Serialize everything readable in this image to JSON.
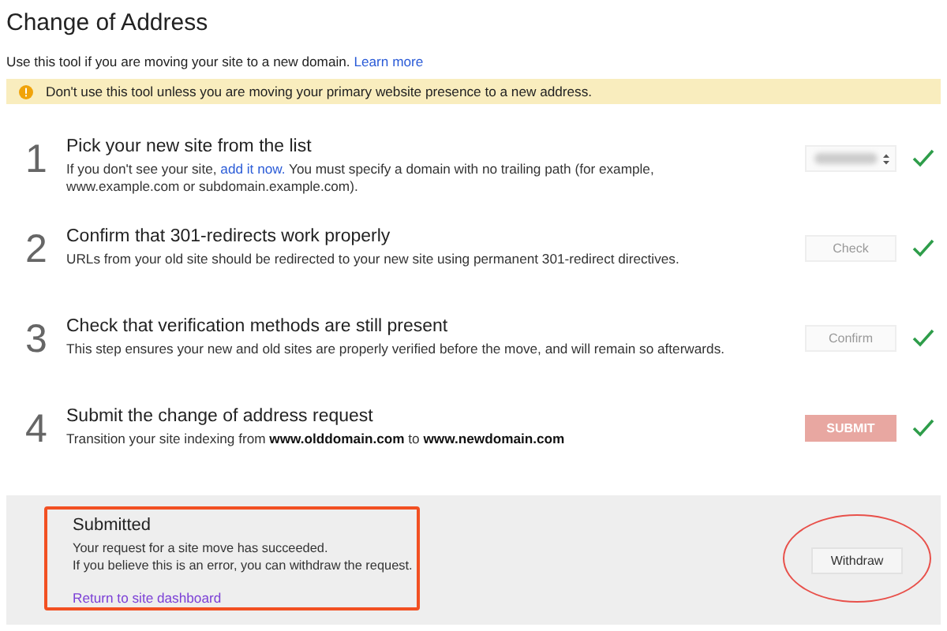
{
  "page": {
    "title": "Change of Address"
  },
  "intro": [
    {
      "kind": "text",
      "text": "Use this tool if you are moving your site to a new domain. "
    },
    {
      "kind": "link",
      "text": "Learn more"
    }
  ],
  "warning": {
    "text": "Don't use this tool unless you are moving your primary website presence to a new address."
  },
  "steps": [
    {
      "number": "1",
      "title": "Pick your new site from the list",
      "description": [
        {
          "kind": "text",
          "text": "If you don't see your site, "
        },
        {
          "kind": "link",
          "text": "add it now."
        },
        {
          "kind": "text",
          "text": " You must specify a domain with no trailing path (for example, www.example.com or subdomain.example.com)."
        }
      ],
      "control": {
        "kind": "select"
      },
      "done": true
    },
    {
      "number": "2",
      "title": "Confirm that 301-redirects work properly",
      "description": [
        {
          "kind": "text",
          "text": "URLs from your old site should be redirected to your new site using permanent 301-redirect directives."
        }
      ],
      "control": {
        "kind": "button",
        "label": "Check",
        "primary": false,
        "disabled": true
      },
      "done": true
    },
    {
      "number": "3",
      "title": "Check that verification methods are still present",
      "description": [
        {
          "kind": "text",
          "text": "This step ensures your new and old sites are properly verified before the move, and will remain so afterwards."
        }
      ],
      "control": {
        "kind": "button",
        "label": "Confirm",
        "primary": false,
        "disabled": true
      },
      "done": true
    },
    {
      "number": "4",
      "title": "Submit the change of address request",
      "description": [
        {
          "kind": "text",
          "text": "Transition your site indexing from **www.olddomain.com** to **www.newdomain.com**"
        }
      ],
      "control": {
        "kind": "button",
        "label": "SUBMIT",
        "primary": true,
        "disabled": true
      },
      "done": true
    }
  ],
  "status": {
    "title": "Submitted",
    "lines": [
      "Your request for a site move has succeeded.",
      "If you believe this is an error, you can withdraw the request."
    ],
    "link": "Return to site dashboard",
    "button": "Withdraw"
  }
}
